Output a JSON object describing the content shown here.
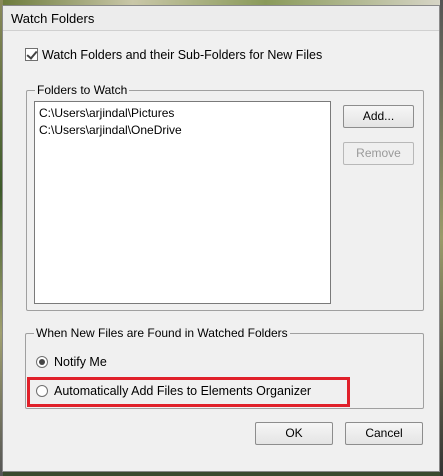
{
  "dialog": {
    "title": "Watch Folders"
  },
  "watch_option": {
    "label": "Watch Folders and their Sub-Folders for New Files",
    "checked": true
  },
  "folders_group": {
    "legend": "Folders to Watch",
    "items": [
      "C:\\Users\\arjindal\\Pictures",
      "C:\\Users\\arjindal\\OneDrive"
    ],
    "add_label": "Add...",
    "remove_label": "Remove",
    "remove_enabled": false
  },
  "new_files_group": {
    "legend": "When New Files are Found in Watched Folders",
    "options": [
      {
        "label": "Notify Me",
        "selected": true
      },
      {
        "label": "Automatically Add Files to Elements Organizer",
        "selected": false
      }
    ],
    "highlight_color": "#e0202a"
  },
  "footer": {
    "ok_label": "OK",
    "cancel_label": "Cancel"
  }
}
